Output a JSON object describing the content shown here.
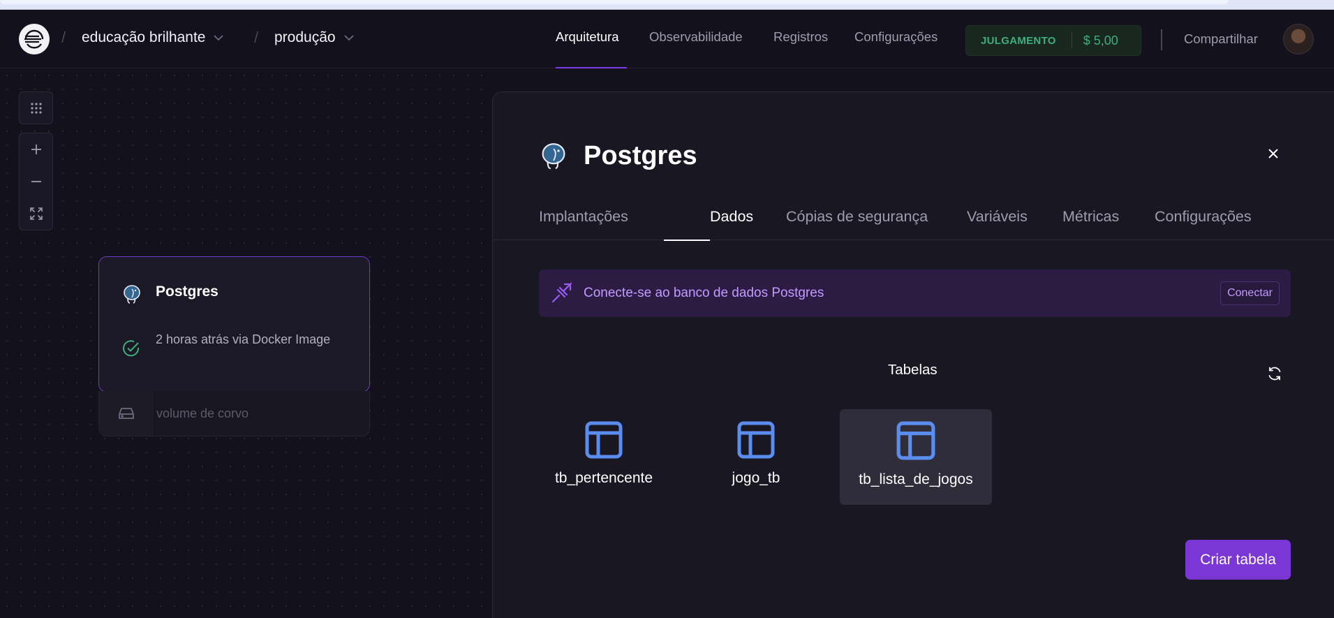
{
  "header": {
    "project": "educação brilhante",
    "environment": "produção",
    "nav": [
      "Arquitetura",
      "Observabilidade",
      "Registros",
      "Configurações"
    ],
    "trial_badge": "JULGAMENTO",
    "trial_amount": "$ 5,00",
    "share_label": "Compartilhar"
  },
  "canvas": {
    "service": {
      "name": "Postgres",
      "status": "2 horas atrás via Docker Image"
    },
    "volume_label": "volume de corvo"
  },
  "panel": {
    "title": "Postgres",
    "tabs": [
      "Implantações",
      "Dados",
      "Cópias de segurança",
      "Variáveis",
      "Métricas",
      "Configurações"
    ],
    "active_tab": "Dados",
    "connect_text": "Conecte-se ao banco de dados Postgres",
    "connect_button": "Conectar",
    "tables_title": "Tabelas",
    "tables": [
      "tb_pertencente",
      "jogo_tb",
      "tb_lista_de_jogos"
    ],
    "selected_table": "tb_lista_de_jogos",
    "create_button": "Criar tabela"
  },
  "colors": {
    "accent": "#7b37d6",
    "trial_green": "#3fae78",
    "table_icon": "#5b8def",
    "connect_text": "#c29bff"
  }
}
